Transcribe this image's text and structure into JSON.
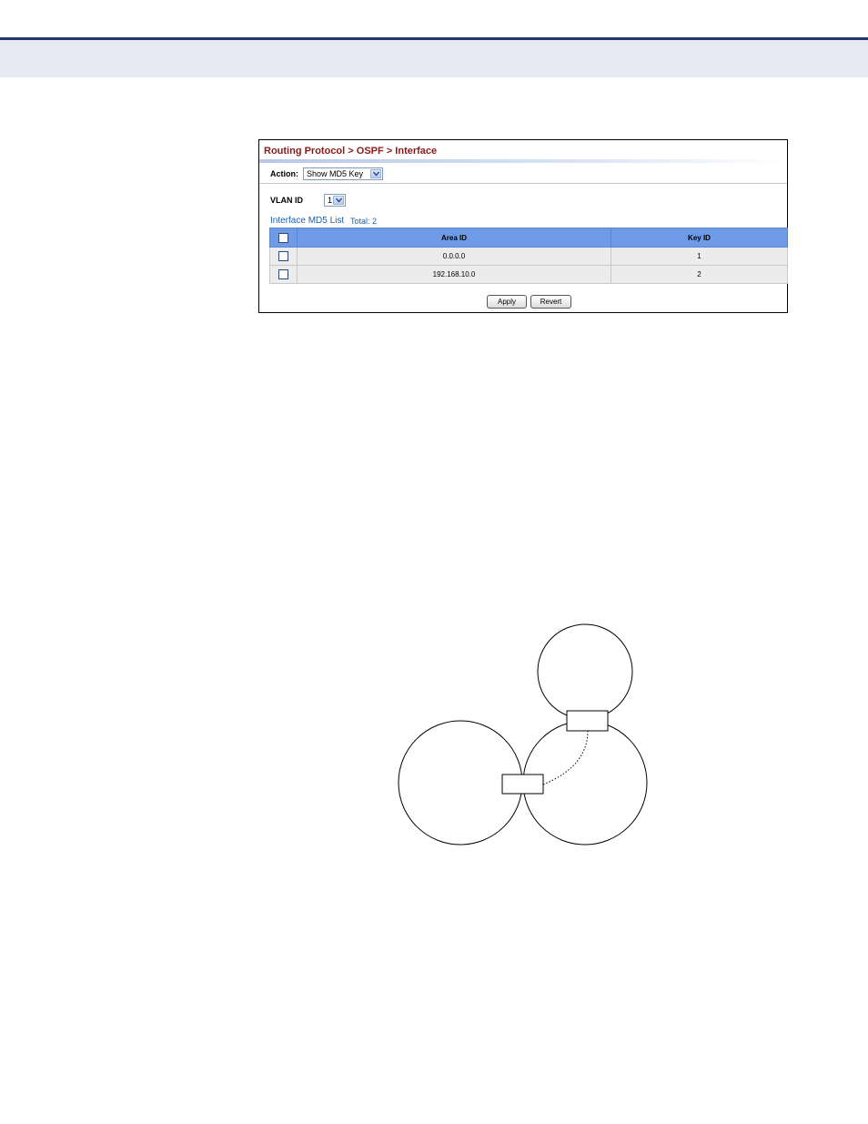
{
  "breadcrumb": {
    "items": [
      "Routing Protocol",
      "OSPF",
      "Interface"
    ],
    "separator": ">"
  },
  "action": {
    "label": "Action:",
    "selected": "Show MD5 Key"
  },
  "vlan": {
    "label": "VLAN ID",
    "selected": "1"
  },
  "list": {
    "title": "Interface MD5 List",
    "total": "Total: 2",
    "columns": [
      "Area ID",
      "Key ID"
    ],
    "rows": [
      {
        "area_id": "0.0.0.0",
        "key_id": "1"
      },
      {
        "area_id": "192.168.10.0",
        "key_id": "2"
      }
    ]
  },
  "buttons": {
    "apply": "Apply",
    "revert": "Revert"
  },
  "colors": {
    "breadcrumb": "#8b1a1a",
    "table_header": "#6f9be6",
    "list_title": "#1f5fa8",
    "top_rule": "#1f3a6e"
  }
}
